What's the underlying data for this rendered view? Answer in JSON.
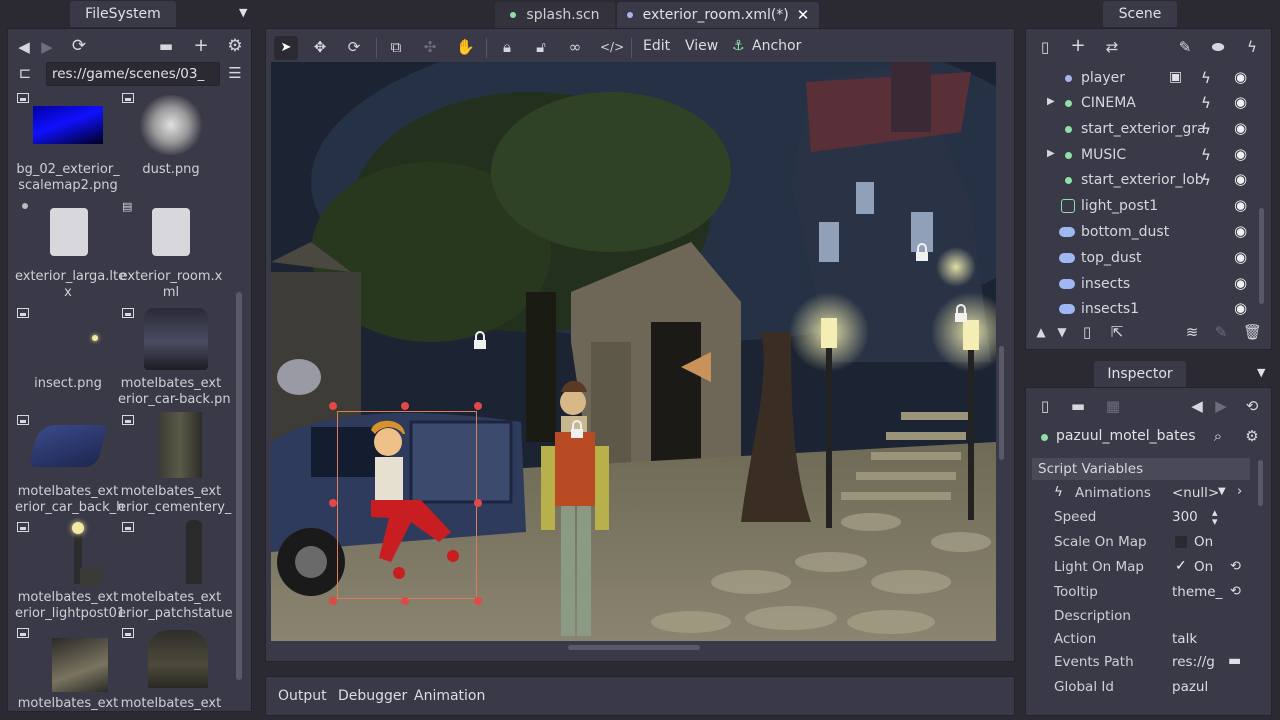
{
  "filesystem": {
    "title": "FileSystem",
    "path": "res://game/scenes/03_",
    "items": [
      {
        "label": "bg_02_exterior_\nscalemap2.png"
      },
      {
        "label": "dust.png"
      },
      {
        "label": "exterior_larga.lte\nx"
      },
      {
        "label": "exterior_room.x\nml"
      },
      {
        "label": "insect.png"
      },
      {
        "label": "motelbates_ext\nerior_car-back.pn"
      },
      {
        "label": "motelbates_ext\nerior_car_back_h"
      },
      {
        "label": "motelbates_ext\nerior_cementery_"
      },
      {
        "label": "motelbates_ext\nerior_lightpost01"
      },
      {
        "label": "motelbates_ext\nerior_patchstatue"
      },
      {
        "label": "motelbates_ext"
      },
      {
        "label": "motelbates_ext"
      }
    ]
  },
  "editor_tabs": [
    {
      "label": "splash.scn",
      "active": false
    },
    {
      "label": "exterior_room.xml(*)",
      "active": true
    }
  ],
  "toolbar": {
    "edit": "Edit",
    "view": "View",
    "anchor": "Anchor"
  },
  "bottom_tabs": [
    "Output",
    "Debugger",
    "Animation"
  ],
  "scene": {
    "title": "Scene",
    "nodes": [
      {
        "name": "player",
        "color": "#a8b4f0"
      },
      {
        "name": "CINEMA",
        "color": "#8fe0a8",
        "expand": true
      },
      {
        "name": "start_exterior_gra",
        "color": "#8fe0a8"
      },
      {
        "name": "MUSIC",
        "color": "#8fe0a8",
        "expand": true
      },
      {
        "name": "start_exterior_lob",
        "color": "#8fe0a8"
      },
      {
        "name": "light_post1",
        "color": "#8fe0a8"
      },
      {
        "name": "bottom_dust",
        "color": "#9fb8f4"
      },
      {
        "name": "top_dust",
        "color": "#9fb8f4"
      },
      {
        "name": "insects",
        "color": "#9fb8f4"
      },
      {
        "name": "insects1",
        "color": "#9fb8f4"
      }
    ]
  },
  "inspector": {
    "title": "Inspector",
    "node_name": "pazuul_motel_bates",
    "section": "Script Variables",
    "props": [
      {
        "key": "Animations",
        "value": "<null>"
      },
      {
        "key": "Speed",
        "value": "300"
      },
      {
        "key": "Scale On Map",
        "value": "On"
      },
      {
        "key": "Light On Map",
        "value": "On"
      },
      {
        "key": "Tooltip",
        "value": "theme_"
      },
      {
        "key": "Description",
        "value": ""
      },
      {
        "key": "Action",
        "value": "talk"
      },
      {
        "key": "Events Path",
        "value": "res://g"
      },
      {
        "key": "Global Id",
        "value": "pazul"
      }
    ]
  },
  "colors": {
    "accent": "#8fe0a8",
    "selection": "#e24848",
    "bg": "#2b2a33",
    "panel": "#3a3947"
  }
}
